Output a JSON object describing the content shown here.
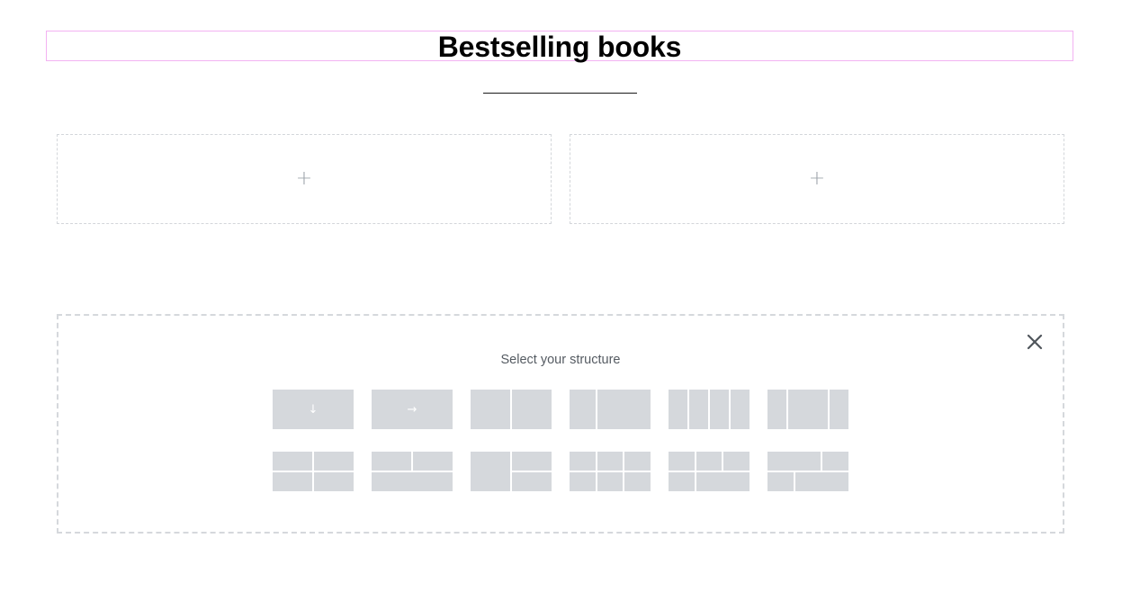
{
  "section": {
    "heading": "Bestselling books"
  },
  "columns": {
    "left_add_icon": "plus-icon",
    "right_add_icon": "plus-icon"
  },
  "structure_selector": {
    "title": "Select your structure",
    "close_icon": "close-icon",
    "presets": [
      {
        "name": "container-column",
        "icon": "arrow-down-icon"
      },
      {
        "name": "container-row",
        "icon": "arrow-right-icon"
      },
      {
        "name": "two-columns-equal"
      },
      {
        "name": "two-columns-wide-right"
      },
      {
        "name": "four-columns"
      },
      {
        "name": "three-columns-wide-center"
      },
      {
        "name": "grid-2x2"
      },
      {
        "name": "two-top-one-bottom"
      },
      {
        "name": "one-left-two-right"
      },
      {
        "name": "grid-3x2"
      },
      {
        "name": "three-top-two-bottom"
      },
      {
        "name": "two-top-two-bottom-offset"
      }
    ]
  },
  "colors": {
    "heading_outline": "#f3b2f2",
    "preset_fill": "#d5d8dc",
    "dashed_border": "#d3d6da",
    "icon_gray": "#9ea4ab"
  }
}
